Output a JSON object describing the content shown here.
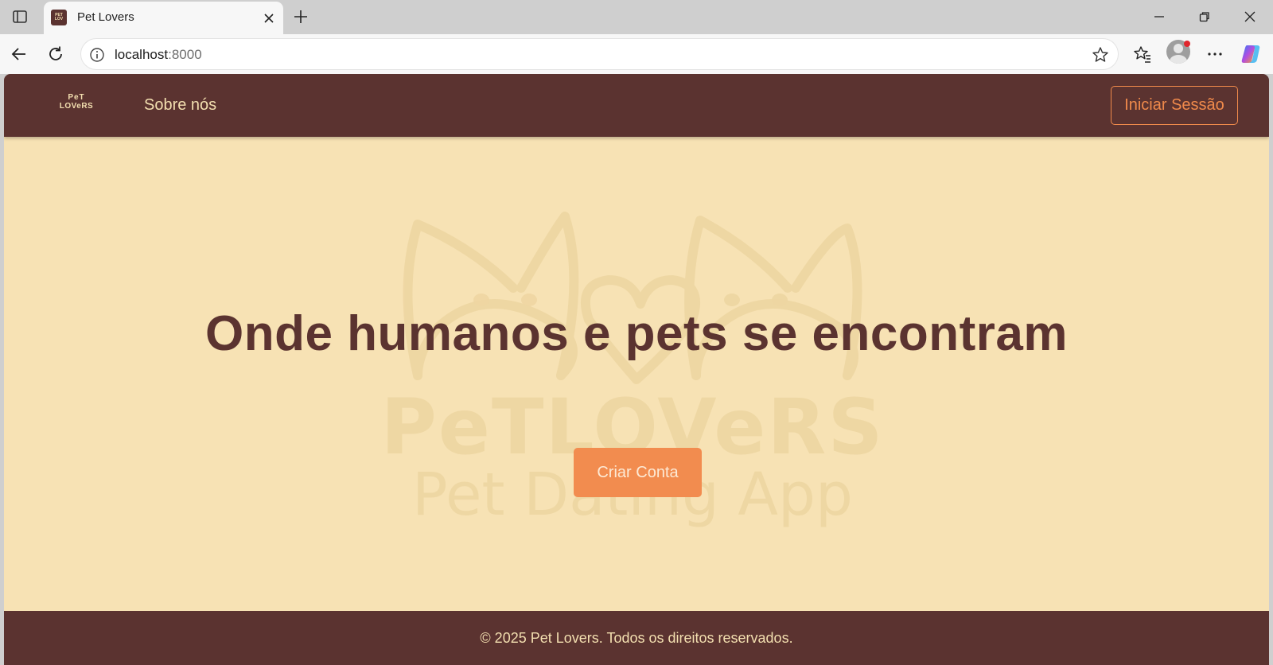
{
  "browser": {
    "tab": {
      "title": "Pet Lovers"
    },
    "address_bar": {
      "host": "localhost",
      "port": ":8000"
    }
  },
  "navbar": {
    "logo": {
      "line1": "PeT",
      "line2": "LOVeRS"
    },
    "about_link": "Sobre nós",
    "login_button": "Iniciar Sessão"
  },
  "hero": {
    "title": "Onde humanos e pets se encontram",
    "cta_button": "Criar Conta",
    "watermark": {
      "brand": "PeTLOVeRS",
      "tagline": "Pet Dating App"
    }
  },
  "footer": {
    "copyright": "© 2025 Pet Lovers. Todos os direitos reservados."
  },
  "colors": {
    "brown": "#5b3330",
    "cream": "#f7e2b4",
    "orange": "#f28c4f",
    "light_text": "#f3dfb0"
  },
  "icons": [
    "sidebar-toggle-icon",
    "close-icon",
    "plus-icon",
    "minimize-icon",
    "restore-icon",
    "back-arrow-icon",
    "reload-icon",
    "info-icon",
    "star-icon",
    "favorites-icon",
    "profile-icon",
    "more-icon",
    "copilot-icon"
  ]
}
